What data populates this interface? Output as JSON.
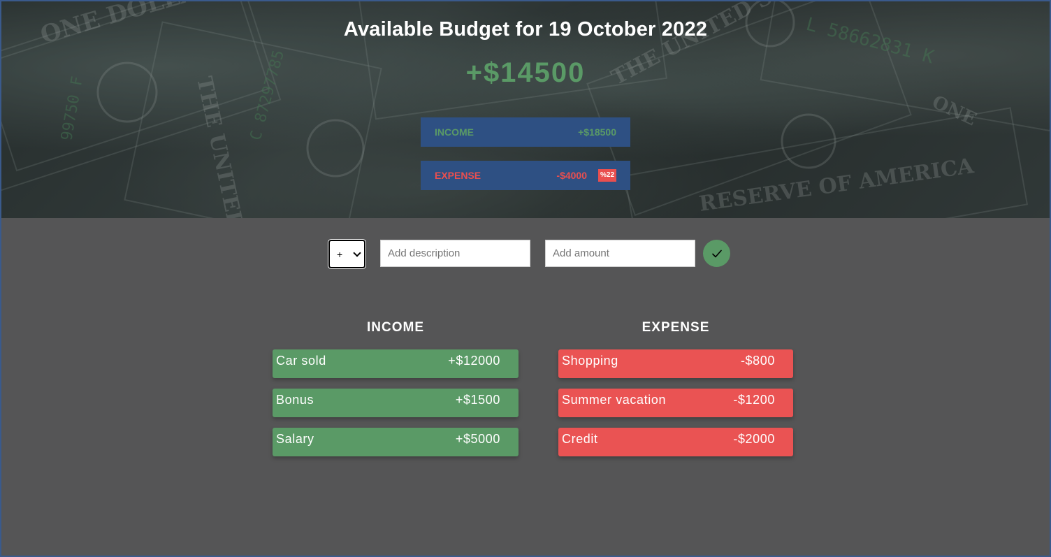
{
  "header": {
    "title": "Available Budget for 19 October 2022",
    "budget": "+$14500",
    "income_summary": {
      "label": "INCOME",
      "amount": "+$18500"
    },
    "expense_summary": {
      "label": "EXPENSE",
      "amount": "-$4000",
      "percentage": "%22"
    }
  },
  "form": {
    "type_value": "+",
    "description_placeholder": "Add description",
    "amount_placeholder": "Add amount",
    "submit_icon": "checkmark-icon"
  },
  "income": {
    "title": "INCOME",
    "items": [
      {
        "description": "Car sold",
        "amount": "+$12000"
      },
      {
        "description": "Bonus",
        "amount": "+$1500"
      },
      {
        "description": "Salary",
        "amount": "+$5000"
      }
    ]
  },
  "expense": {
    "title": "EXPENSE",
    "items": [
      {
        "description": "Shopping",
        "amount": "-$800"
      },
      {
        "description": "Summer vacation",
        "amount": "-$1200"
      },
      {
        "description": "Credit",
        "amount": "-$2000"
      }
    ]
  },
  "colors": {
    "income": "#5a9a66",
    "expense": "#ea5353",
    "summary_bg": "#2e5083",
    "page_bg": "#555556"
  }
}
